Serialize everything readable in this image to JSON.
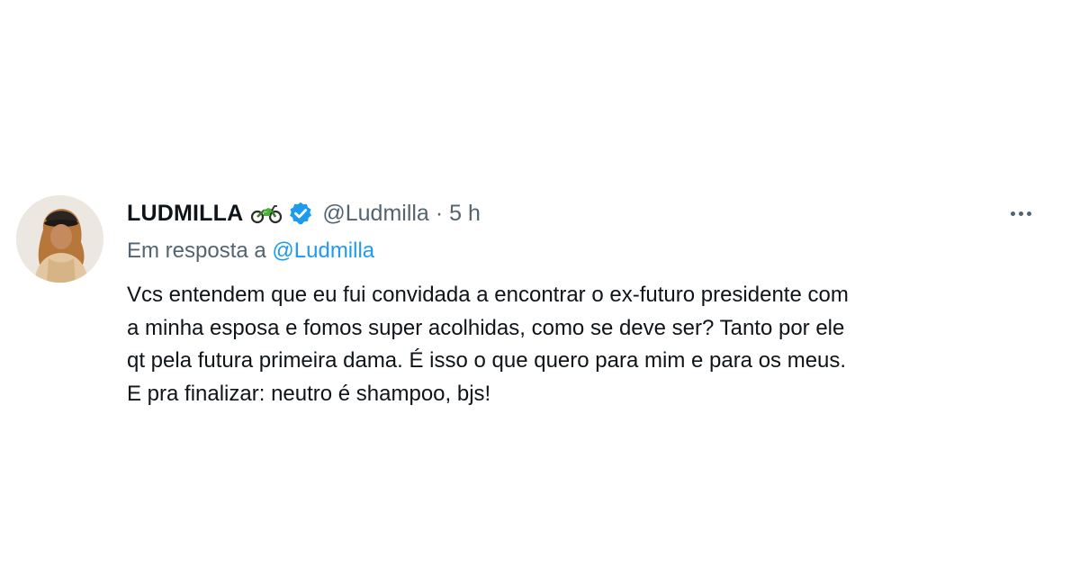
{
  "tweet": {
    "display_name": "LUDMILLA",
    "name_emoji_icon": "motorcycle-icon",
    "verified_icon": "verified-badge-icon",
    "handle": "@Ludmilla",
    "separator": "·",
    "time": "5 h",
    "more_icon": "more-options-icon",
    "reply_prefix": "Em resposta a",
    "reply_mention": "@Ludmilla",
    "text_lines": [
      "Vcs entendem que eu fui convidada a encontrar o ex-futuro presidente com",
      "a minha esposa e fomos super acolhidas, como se deve ser? Tanto por ele",
      "qt pela futura primeira dama. É isso o que quero para mim e para os meus.",
      "E pra finalizar: neutro é shampoo, bjs!"
    ]
  },
  "colors": {
    "text": "#0f1419",
    "secondary": "#536471",
    "accent": "#1d9bf0",
    "background": "#ffffff"
  }
}
